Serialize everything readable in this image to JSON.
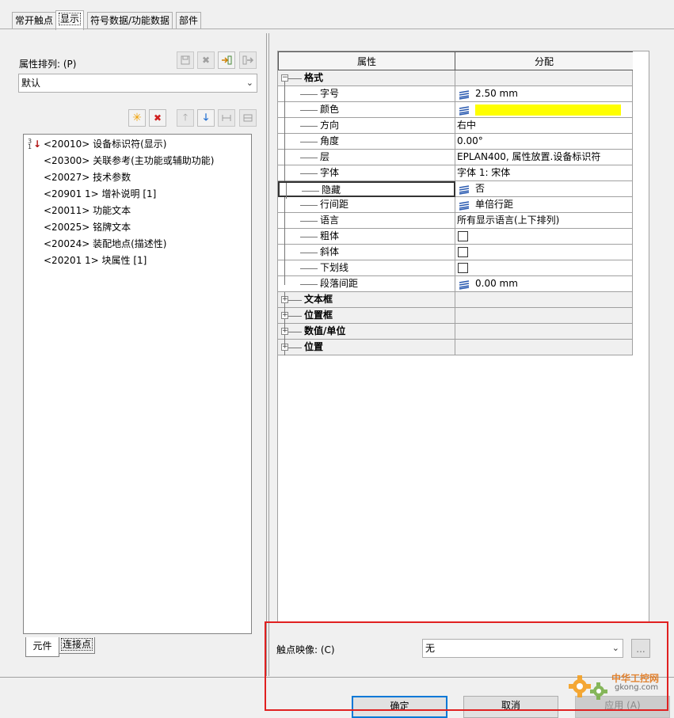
{
  "tabs": [
    "常开触点",
    "显示",
    "符号数据/功能数据",
    "部件"
  ],
  "left": {
    "sort_label": "属性排列: (P)",
    "sort_value": "默认",
    "tree_items": [
      "<20010> 设备标识符(显示)",
      "<20300> 关联参考(主功能或辅助功能)",
      "<20027> 技术参数",
      "<20901 1> 增补说明 [1]",
      "<20011> 功能文本",
      "<20025> 铭牌文本",
      "<20024> 装配地点(描述性)",
      "<20201 1> 块属性 [1]"
    ],
    "bottom_tabs": [
      "元件",
      "连接点"
    ]
  },
  "grid": {
    "header": [
      "属性",
      "分配"
    ],
    "rows": [
      {
        "label": "格式",
        "value": "",
        "group": true,
        "expanded": true
      },
      {
        "label": "字号",
        "value": "2.50 mm",
        "icon": "layer-icon"
      },
      {
        "label": "颜色",
        "value": "",
        "icon": "layer-icon",
        "swatch": "#ffff00"
      },
      {
        "label": "方向",
        "value": "右中"
      },
      {
        "label": "角度",
        "value": "0.00°"
      },
      {
        "label": "层",
        "value": "EPLAN400, 属性放置.设备标识符"
      },
      {
        "label": "字体",
        "value": "字体 1: 宋体"
      },
      {
        "label": "隐藏",
        "value": "否",
        "icon": "layer-icon",
        "selected": true
      },
      {
        "label": "行间距",
        "value": "单倍行距",
        "icon": "layer-icon"
      },
      {
        "label": "语言",
        "value": "所有显示语言(上下排列)"
      },
      {
        "label": "粗体",
        "value": "",
        "checkbox": true
      },
      {
        "label": "斜体",
        "value": "",
        "checkbox": true
      },
      {
        "label": "下划线",
        "value": "",
        "checkbox": true
      },
      {
        "label": "段落间距",
        "value": "0.00 mm",
        "icon": "layer-icon"
      },
      {
        "label": "文本框",
        "value": "",
        "group": true
      },
      {
        "label": "位置框",
        "value": "",
        "group": true
      },
      {
        "label": "数值/单位",
        "value": "",
        "group": true
      },
      {
        "label": "位置",
        "value": "",
        "group": true
      }
    ]
  },
  "mapping": {
    "label": "触点映像: (C)",
    "value": "无",
    "browse": "..."
  },
  "buttons": {
    "ok": "确定",
    "cancel": "取消",
    "apply": "应用 (A)"
  },
  "watermark": {
    "line1": "中华工控网",
    "line2": "gkong.com"
  },
  "colors": {
    "highlight_box": "#e02020",
    "swatch": "#ffff00",
    "accent": "#0078d7"
  }
}
